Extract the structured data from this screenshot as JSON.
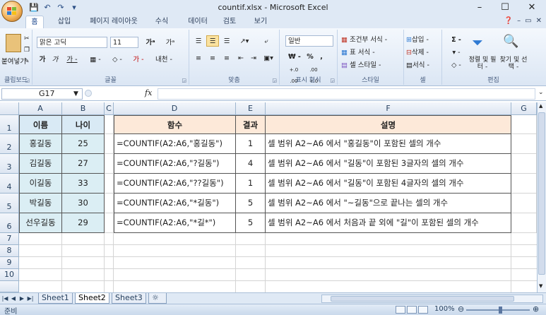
{
  "window": {
    "title": "countif.xlsx - Microsoft Excel",
    "minimize": "–",
    "maximize": "☐",
    "close": "✕"
  },
  "qat": [
    "💾",
    "↶",
    "↷",
    "▾"
  ],
  "tabs": [
    "홈",
    "삽입",
    "페이지 레이아웃",
    "수식",
    "데이터",
    "검토",
    "보기"
  ],
  "tab_icons": [
    "❓",
    "–",
    "▭",
    "✕"
  ],
  "ribbon": {
    "clipboard": {
      "paste": "붙여넣기",
      "label": "클립보드"
    },
    "font": {
      "name": "맑은 고딕",
      "size": "11",
      "grow": "가ᵃ",
      "shrink": "가ᵃ",
      "bold": "가",
      "italic": "가",
      "underline": "가 -",
      "border": "▦ -",
      "fill": "◇ -",
      "color": "가 -",
      "phonetic": "내천 -",
      "label": "글꼴"
    },
    "align": {
      "label": "맞춤"
    },
    "number": {
      "format": "일반",
      "currency": "₩ -",
      "percent": "%",
      "comma": ",",
      "inc": "+.0 .00",
      "dec": ".00 +.0",
      "label": "표시 형식"
    },
    "styles": {
      "cond": "조건부 서식 -",
      "table": "표 서식 -",
      "cell": "셀 스타일 -",
      "label": "스타일"
    },
    "cells": {
      "insert": "삽입 -",
      "delete": "삭제 -",
      "format": "서식 -",
      "label": "셀"
    },
    "editing": {
      "sum": "Σ -",
      "fill": "▾ -",
      "clear": "◇ -",
      "sort": "정렬 및 필터 -",
      "find": "찾기 및 선택 -",
      "label": "편집"
    }
  },
  "namebox": "G17",
  "fx": "fx",
  "columns": [
    "A",
    "B",
    "C",
    "D",
    "E",
    "F",
    "G"
  ],
  "rows": [
    "1",
    "2",
    "3",
    "4",
    "5",
    "6",
    "7",
    "8",
    "9",
    "10"
  ],
  "table_left": {
    "headers": [
      "이름",
      "나이"
    ],
    "rows": [
      [
        "홍길동",
        "25"
      ],
      [
        "김길동",
        "27"
      ],
      [
        "이길동",
        "33"
      ],
      [
        "박길동",
        "30"
      ],
      [
        "선우길동",
        "29"
      ]
    ]
  },
  "table_right": {
    "headers": [
      "함수",
      "결과",
      "설명"
    ],
    "rows": [
      [
        "=COUNTIF(A2:A6,\"홍길동\")",
        "1",
        "셀 범위 A2~A6 에서 \"홍길동\"이 포함된 셀의 개수"
      ],
      [
        "=COUNTIF(A2:A6,\"?길동\")",
        "4",
        "셀 범위 A2~A6 에서 \"길동\"이 포함된 3글자의 셀의 개수"
      ],
      [
        "=COUNTIF(A2:A6,\"??길동\")",
        "1",
        "셀 범위 A2~A6 에서 \"길동\"이 포함된 4글자의 셀의 개수"
      ],
      [
        "=COUNTIF(A2:A6,\"*길동\")",
        "5",
        "셀 범위 A2~A6 에서 \"~길동\"으로 끝나는 셀의 개수"
      ],
      [
        "=COUNTIF(A2:A6,\"*길*\")",
        "5",
        "셀 범위 A2~A6 에서 처음과 끝 외에 \"길\"이 포함된 셀의 개수"
      ]
    ]
  },
  "sheets": [
    "Sheet1",
    "Sheet2",
    "Sheet3"
  ],
  "active_sheet": "Sheet2",
  "status": {
    "text": "준비",
    "zoom": "100%"
  }
}
